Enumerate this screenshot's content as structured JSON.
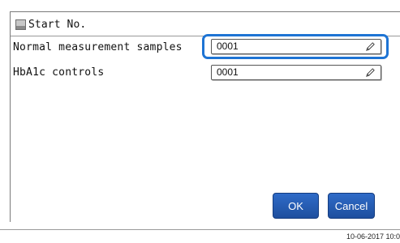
{
  "dialog": {
    "title": "Start No.",
    "fields": [
      {
        "label": "Normal measurement samples",
        "value": "0001",
        "icon": "pencil-icon",
        "focused": true
      },
      {
        "label": "HbA1c controls",
        "value": "0001",
        "icon": "pencil-icon",
        "focused": false
      }
    ],
    "ok_label": "OK",
    "cancel_label": "Cancel"
  },
  "status": {
    "datetime": "10-06-2017 10:0"
  },
  "colors": {
    "accent": "#1e74d4",
    "button": "#2559b3"
  }
}
